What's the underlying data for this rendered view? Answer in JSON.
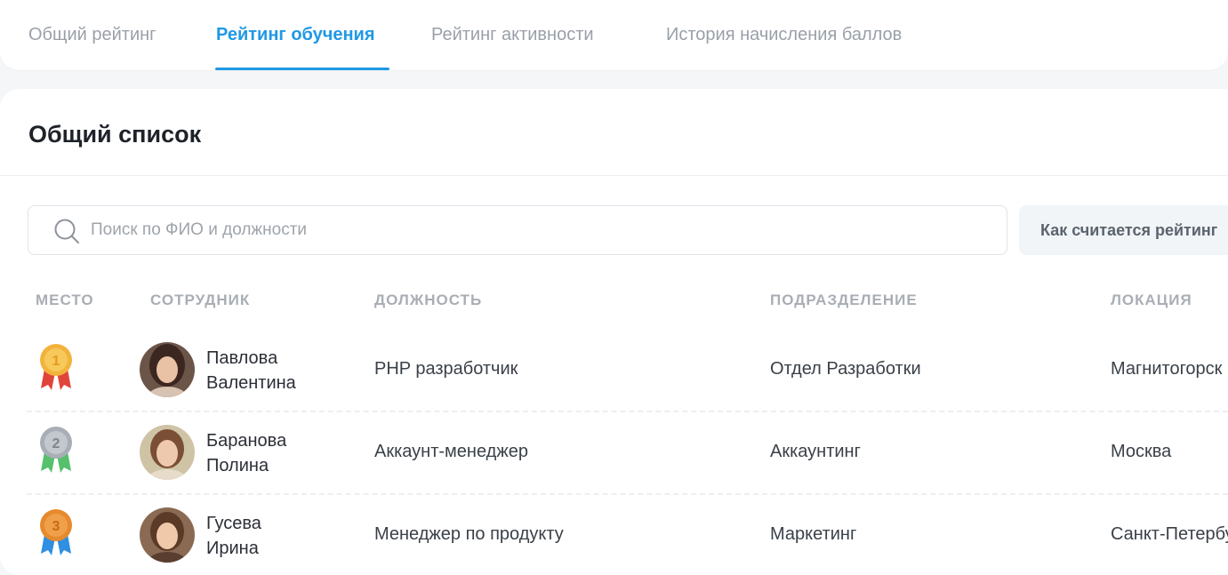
{
  "tabs": [
    {
      "label": "Общий рейтинг",
      "active": false
    },
    {
      "label": "Рейтинг обучения",
      "active": true
    },
    {
      "label": "Рейтинг активности",
      "active": false
    },
    {
      "label": "История начисления баллов",
      "active": false
    }
  ],
  "section": {
    "title": "Общий список"
  },
  "search": {
    "placeholder": "Поиск по ФИО и должности",
    "value": ""
  },
  "how_button": {
    "label": "Как считается рейтинг"
  },
  "table": {
    "columns": [
      "МЕСТО",
      "СОТРУДНИК",
      "ДОЛЖНОСТЬ",
      "ПОДРАЗДЕЛЕНИЕ",
      "ЛОКАЦИЯ"
    ],
    "rows": [
      {
        "place": "1",
        "medal": "gold-medal-icon",
        "first_line": "Павлова",
        "second_line": "Валентина",
        "position": "PHP разработчик",
        "department": "Отдел Разработки",
        "location": "Магнитогорск"
      },
      {
        "place": "2",
        "medal": "silver-medal-icon",
        "first_line": "Баранова",
        "second_line": "Полина",
        "position": "Аккаунт-менеджер",
        "department": "Аккаунтинг",
        "location": "Москва"
      },
      {
        "place": "3",
        "medal": "bronze-medal-icon",
        "first_line": "Гусева",
        "second_line": "Ирина",
        "position": "Менеджер по продукту",
        "department": "Маркетинг",
        "location": "Санкт-Петербург"
      }
    ]
  },
  "colors": {
    "accent": "#1f98e5",
    "gold": "#f2b33d",
    "silver": "#a7aeb6",
    "bronze": "#e68a2e"
  }
}
